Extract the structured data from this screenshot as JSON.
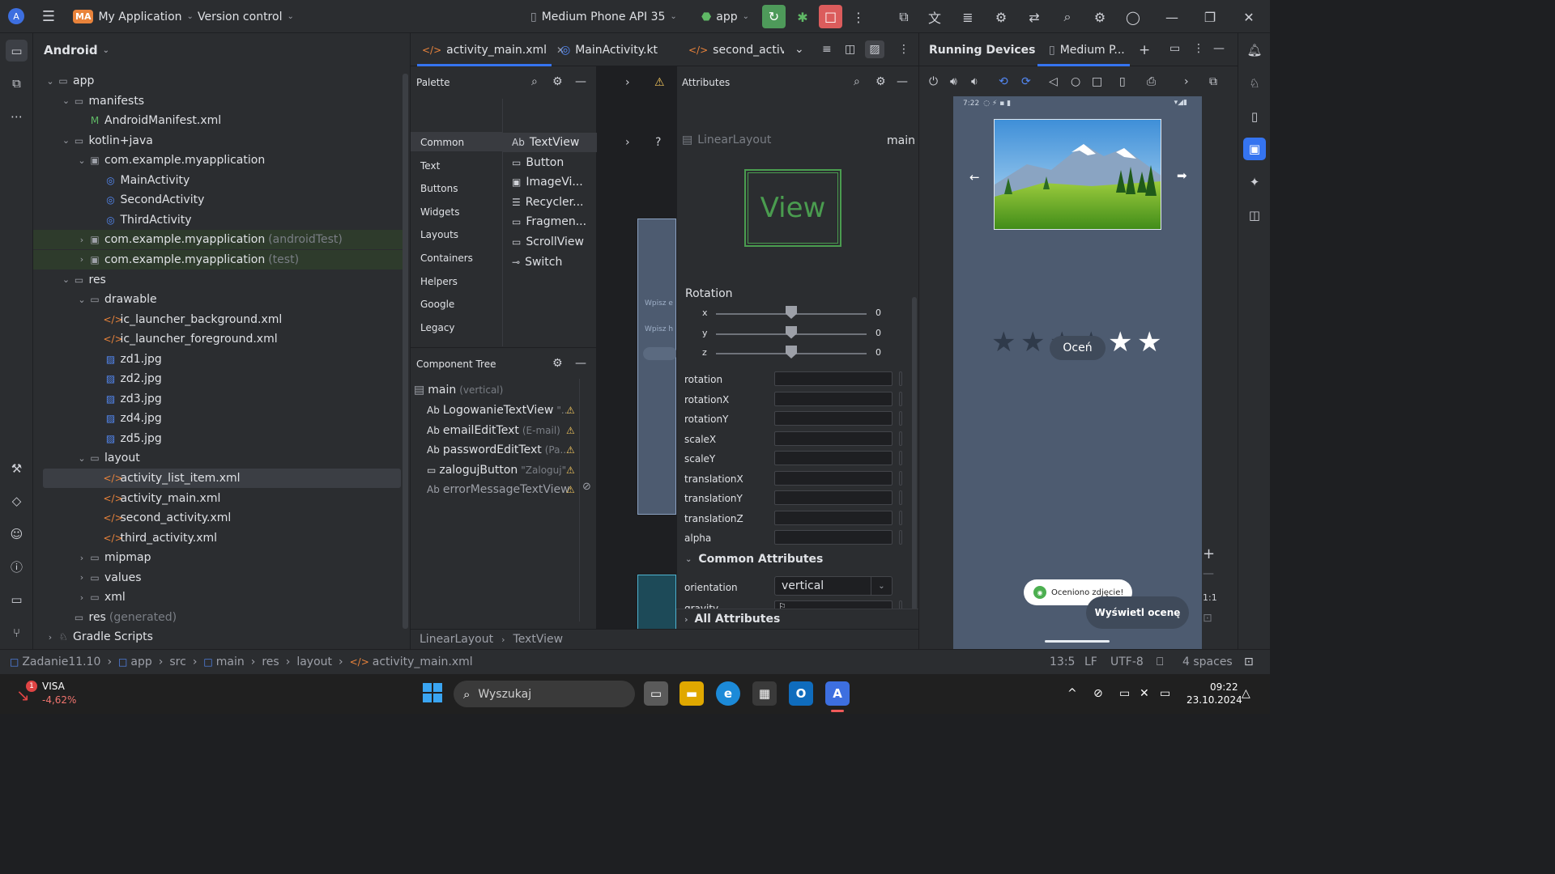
{
  "titlebar": {
    "project_badge": "MA",
    "project_name": "My Application",
    "vcs": "Version control",
    "device": "Medium Phone API 35",
    "run_config": "app"
  },
  "project_panel": {
    "view_mode": "Android",
    "tree": [
      {
        "label": "app",
        "dim": "",
        "icon": "folder-module-icon",
        "expanded": true
      },
      {
        "label": "manifests",
        "dim": "",
        "icon": "folder-icon",
        "expanded": true
      },
      {
        "label": "AndroidManifest.xml",
        "dim": "",
        "icon": "manifest-icon"
      },
      {
        "label": "kotlin+java",
        "dim": "",
        "icon": "folder-icon",
        "expanded": true
      },
      {
        "label": "com.example.myapplication",
        "dim": "",
        "icon": "package-icon",
        "expanded": true
      },
      {
        "label": "MainActivity",
        "dim": "",
        "icon": "activity-class-icon"
      },
      {
        "label": "SecondActivity",
        "dim": "",
        "icon": "activity-class-icon"
      },
      {
        "label": "ThirdActivity",
        "dim": "",
        "icon": "activity-class-icon"
      },
      {
        "label": "com.example.myapplication",
        "dim": "(androidTest)",
        "icon": "package-icon"
      },
      {
        "label": "com.example.myapplication",
        "dim": "(test)",
        "icon": "package-icon"
      },
      {
        "label": "res",
        "dim": "",
        "icon": "folder-res-icon",
        "expanded": true
      },
      {
        "label": "drawable",
        "dim": "",
        "icon": "folder-icon",
        "expanded": true
      },
      {
        "label": "ic_launcher_background.xml",
        "dim": "",
        "icon": "xml-icon"
      },
      {
        "label": "ic_launcher_foreground.xml",
        "dim": "",
        "icon": "xml-icon"
      },
      {
        "label": "zd1.jpg",
        "dim": "",
        "icon": "image-file-icon"
      },
      {
        "label": "zd2.jpg",
        "dim": "",
        "icon": "image-file-icon"
      },
      {
        "label": "zd3.jpg",
        "dim": "",
        "icon": "image-file-icon"
      },
      {
        "label": "zd4.jpg",
        "dim": "",
        "icon": "image-file-icon"
      },
      {
        "label": "zd5.jpg",
        "dim": "",
        "icon": "image-file-icon"
      },
      {
        "label": "layout",
        "dim": "",
        "icon": "folder-icon",
        "expanded": true
      },
      {
        "label": "activity_list_item.xml",
        "dim": "",
        "icon": "xml-icon"
      },
      {
        "label": "activity_main.xml",
        "dim": "",
        "icon": "xml-icon"
      },
      {
        "label": "second_activity.xml",
        "dim": "",
        "icon": "xml-icon"
      },
      {
        "label": "third_activity.xml",
        "dim": "",
        "icon": "xml-icon"
      },
      {
        "label": "mipmap",
        "dim": "",
        "icon": "folder-icon"
      },
      {
        "label": "values",
        "dim": "",
        "icon": "folder-icon"
      },
      {
        "label": "xml",
        "dim": "",
        "icon": "folder-icon"
      },
      {
        "label": "res",
        "dim": "(generated)",
        "icon": "folder-res-icon"
      },
      {
        "label": "Gradle Scripts",
        "dim": "",
        "icon": "gradle-icon"
      }
    ]
  },
  "editor_tabs": [
    "activity_main.xml",
    "MainActivity.kt",
    "second_activity"
  ],
  "palette": {
    "title": "Palette",
    "categories": [
      "Common",
      "Text",
      "Buttons",
      "Widgets",
      "Layouts",
      "Containers",
      "Helpers",
      "Google",
      "Legacy"
    ],
    "items": [
      {
        "glyph": "Ab",
        "label": "TextView"
      },
      {
        "glyph": "▭",
        "label": "Button"
      },
      {
        "glyph": "▣",
        "label": "ImageVi..."
      },
      {
        "glyph": "☰",
        "label": "Recycler..."
      },
      {
        "glyph": "▭",
        "label": "Fragmen..."
      },
      {
        "glyph": "▭",
        "label": "ScrollView"
      },
      {
        "glyph": "⊸",
        "label": "Switch"
      }
    ]
  },
  "component_tree": {
    "title": "Component Tree",
    "root": "main",
    "root_dim": "(vertical)",
    "rows": [
      {
        "glyph": "Ab",
        "label": "LogowanieTextView",
        "dim": "\"..."
      },
      {
        "glyph": "Ab",
        "label": "emailEditText",
        "dim": "(E-mail)"
      },
      {
        "glyph": "Ab",
        "label": "passwordEditText",
        "dim": "(Pa..."
      },
      {
        "glyph": "▭",
        "label": "zalogujButton",
        "dim": "\"Zaloguj\""
      },
      {
        "glyph": "Ab",
        "label": "errorMessageTextView",
        "dim": ""
      }
    ]
  },
  "design_canvas": {
    "hint1": "Wpisz e",
    "hint2": "Wpisz h"
  },
  "attributes": {
    "title": "Attributes",
    "component": "LinearLayout",
    "id": "main",
    "preview": "View",
    "rotation_title": "Rotation",
    "sliders": [
      {
        "axis": "x",
        "value": "0"
      },
      {
        "axis": "y",
        "value": "0"
      },
      {
        "axis": "z",
        "value": "0"
      }
    ],
    "fields": [
      "rotation",
      "rotationX",
      "rotationY",
      "scaleX",
      "scaleY",
      "translationX",
      "translationY",
      "translationZ",
      "alpha"
    ],
    "common_title": "Common Attributes",
    "orientation_label": "orientation",
    "orientation_value": "vertical",
    "gravity_label": "gravity",
    "alpha_label": "alpha",
    "all_title": "All Attributes"
  },
  "breadcrumb_bottom": [
    "LinearLayout",
    "TextView"
  ],
  "running_devices": {
    "title": "Running Devices",
    "tab": "Medium P...",
    "phone_time": "7:22",
    "rating": {
      "filled": 4,
      "total": 6
    },
    "rate_button": "Oceń",
    "toast": "Oceniono zdjęcie!",
    "show_ratings": "Wyświetl ocenę",
    "zoom_label": "1:1"
  },
  "statusbar": {
    "path": [
      "Zadanie11.10",
      "app",
      "src",
      "main",
      "res",
      "layout",
      "activity_main.xml"
    ],
    "position": "13:5",
    "line_sep": "LF",
    "encoding": "UTF-8",
    "indent": "4 spaces"
  },
  "taskbar": {
    "stock_name": "VISA",
    "stock_change": "-4,62%",
    "search_placeholder": "Wyszukaj",
    "time": "09:22",
    "date": "23.10.2024"
  }
}
